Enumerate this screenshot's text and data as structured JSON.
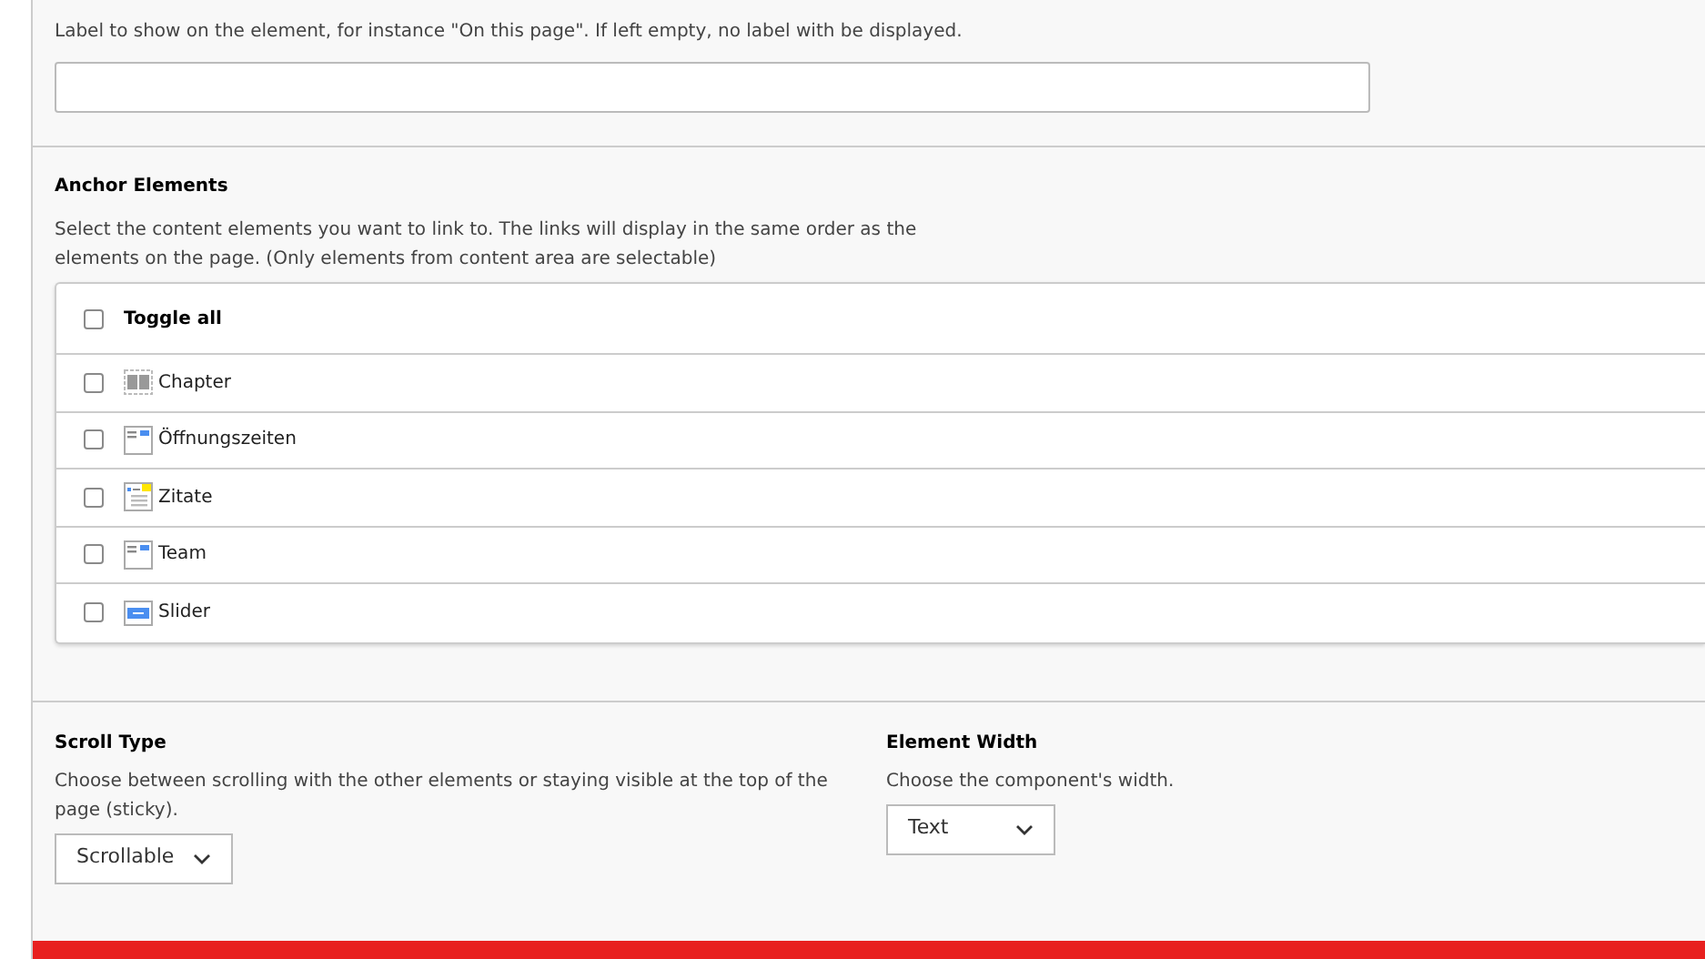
{
  "label_field": {
    "description": "Label to show on the element, for instance \"On this page\". If left empty, no label with be displayed."
  },
  "anchor_elements": {
    "title": "Anchor Elements",
    "description": "Select the content elements you want to link to. The links will display in the same order as the elements on the page. (Only elements from content area are selectable)",
    "toggle_all": {
      "label": "Toggle all",
      "checked": false
    },
    "items": [
      {
        "label": "Chapter",
        "kind": "chapter",
        "checked": false
      },
      {
        "label": "Öffnungszeiten",
        "kind": "text",
        "checked": false
      },
      {
        "label": "Zitate",
        "kind": "quote",
        "checked": false
      },
      {
        "label": "Team",
        "kind": "text",
        "checked": false
      },
      {
        "label": "Slider",
        "kind": "slider",
        "checked": false
      }
    ]
  },
  "scroll_type": {
    "title": "Scroll Type",
    "description": "Choose between scrolling with the other elements or staying visible at the top of the page (sticky).",
    "value": "Scrollable"
  },
  "element_width": {
    "title": "Element Width",
    "description": "Choose the component's width.",
    "value": "Text"
  }
}
